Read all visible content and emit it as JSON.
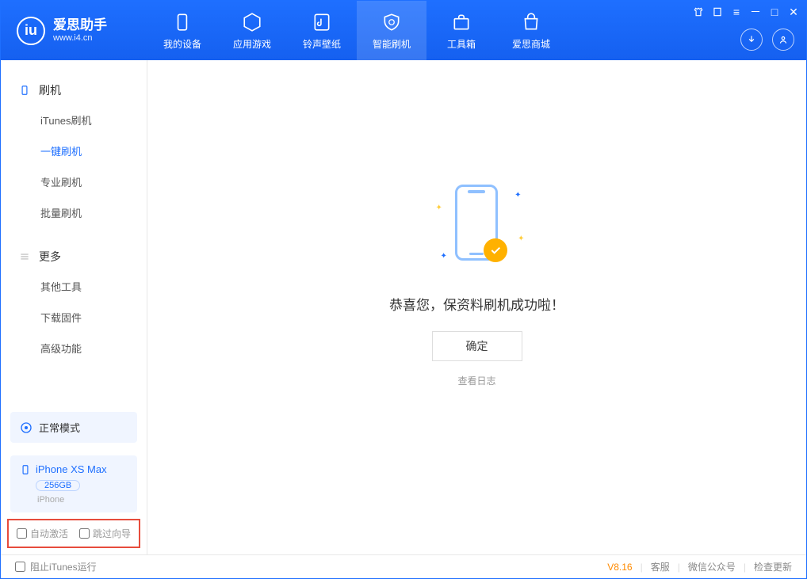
{
  "app": {
    "title": "爱思助手",
    "subtitle": "www.i4.cn"
  },
  "nav": [
    {
      "label": "我的设备"
    },
    {
      "label": "应用游戏"
    },
    {
      "label": "铃声壁纸"
    },
    {
      "label": "智能刷机"
    },
    {
      "label": "工具箱"
    },
    {
      "label": "爱思商城"
    }
  ],
  "sidebar": {
    "section1": {
      "title": "刷机",
      "items": [
        "iTunes刷机",
        "一键刷机",
        "专业刷机",
        "批量刷机"
      ]
    },
    "section2": {
      "title": "更多",
      "items": [
        "其他工具",
        "下载固件",
        "高级功能"
      ]
    }
  },
  "device_status": {
    "mode": "正常模式",
    "name": "iPhone XS Max",
    "capacity": "256GB",
    "type": "iPhone"
  },
  "checkbox_row": {
    "auto_activate": "自动激活",
    "skip_guide": "跳过向导"
  },
  "main": {
    "message": "恭喜您，保资料刷机成功啦！",
    "ok": "确定",
    "view_log": "查看日志"
  },
  "footer": {
    "block_itunes": "阻止iTunes运行",
    "version": "V8.16",
    "links": [
      "客服",
      "微信公众号",
      "检查更新"
    ]
  }
}
